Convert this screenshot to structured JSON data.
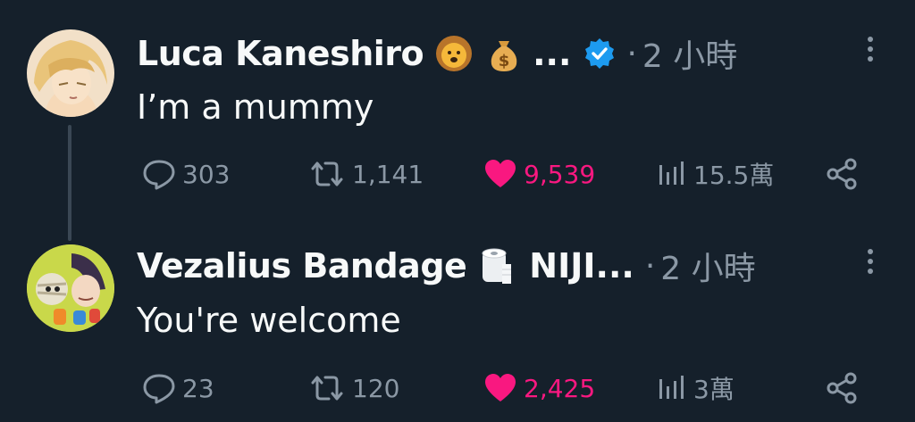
{
  "tweets": [
    {
      "author": {
        "display_name": "Luca Kaneshiro",
        "emojis": [
          "lion-emoji",
          "money-bag-emoji"
        ],
        "name_truncation": "...",
        "verified": true
      },
      "time_sep": "·",
      "time": "2 小時",
      "text": "I’m a mummy",
      "stats": {
        "replies": "303",
        "retweets": "1,141",
        "likes": "9,539",
        "views": "15.5萬"
      },
      "liked": true
    },
    {
      "author": {
        "display_name": "Vezalius Bandage",
        "emojis": [
          "toilet-paper-emoji"
        ],
        "name_suffix": "NIJI...",
        "verified": false
      },
      "time_sep": "·",
      "time": "2 小時",
      "text": "You're welcome",
      "stats": {
        "replies": "23",
        "retweets": "120",
        "likes": "2,425",
        "views": "3萬"
      },
      "liked": true
    }
  ],
  "colors": {
    "background": "#15202b",
    "text_primary": "#f7f9f9",
    "text_secondary": "#8b98a5",
    "like_pink": "#f91880",
    "verified_blue": "#1d9bf0"
  },
  "icons": {
    "reply": "reply-icon",
    "retweet": "retweet-icon",
    "like": "heart-icon",
    "views": "views-icon",
    "share": "share-icon",
    "more": "more-options-icon"
  }
}
